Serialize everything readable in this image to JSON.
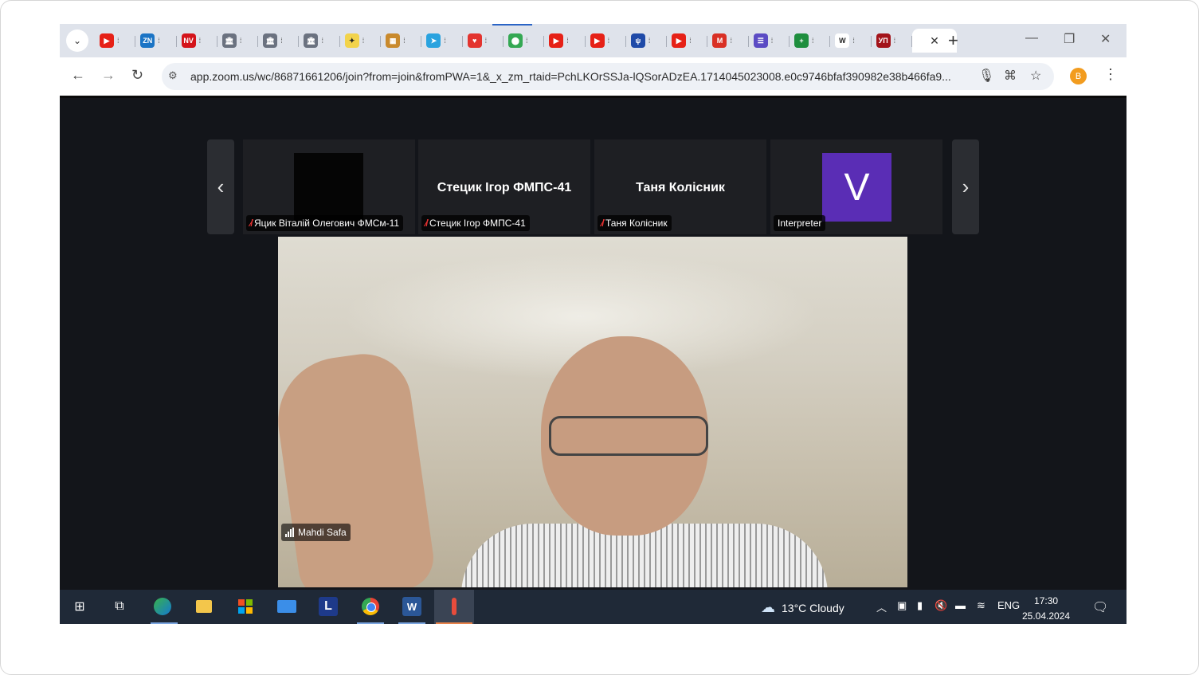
{
  "browser": {
    "tabs": [
      {
        "icon": "youtube-icon",
        "color": "#e62117",
        "glyph": "▶"
      },
      {
        "icon": "zn-icon",
        "color": "#1b74c5",
        "glyph": "ZN"
      },
      {
        "icon": "nv-icon",
        "color": "#d4141b",
        "glyph": "NV"
      },
      {
        "icon": "bank-icon",
        "color": "#6b7280",
        "glyph": "🏛"
      },
      {
        "icon": "bank-icon",
        "color": "#6b7280",
        "glyph": "🏛"
      },
      {
        "icon": "bank-icon",
        "color": "#6b7280",
        "glyph": "🏛"
      },
      {
        "icon": "star-icon",
        "color": "#f2d34b",
        "glyph": "✦"
      },
      {
        "icon": "basket-icon",
        "color": "#c98a2d",
        "glyph": "▦"
      },
      {
        "icon": "telegram-icon",
        "color": "#2aa3df",
        "glyph": "➤"
      },
      {
        "icon": "heart-icon",
        "color": "#e3342f",
        "glyph": "♥"
      },
      {
        "icon": "maps-icon",
        "color": "#34a853",
        "glyph": "⬤"
      },
      {
        "icon": "youtube-icon",
        "color": "#e62117",
        "glyph": "▶"
      },
      {
        "icon": "youtube-icon",
        "color": "#e62117",
        "glyph": "▶"
      },
      {
        "icon": "trident-icon",
        "color": "#1f4aa8",
        "glyph": "ψ"
      },
      {
        "icon": "youtube-icon",
        "color": "#e62117",
        "glyph": "▶"
      },
      {
        "icon": "gmail-icon",
        "color": "#d93025",
        "glyph": "M"
      },
      {
        "icon": "list-icon",
        "color": "#5b4bc4",
        "glyph": "☰"
      },
      {
        "icon": "sheets-plus-icon",
        "color": "#1e8e3e",
        "glyph": "+"
      },
      {
        "icon": "wikipedia-icon",
        "color": "#ffffff",
        "glyph": "W"
      },
      {
        "icon": "up-icon",
        "color": "#a3131a",
        "glyph": "УП"
      }
    ],
    "new_tab": "+",
    "url": "app.zoom.us/wc/86871661206/join?from=join&fromPWA=1&_x_zm_rtaid=PchLKOrSSJa-lQSorADzEA.1714045023008.e0c9746bfaf390982e38b466fa9...",
    "profile_initial": "B"
  },
  "zoom": {
    "participants": [
      {
        "label": "Яцик Віталій Олегович ФМСм-11",
        "muted": true,
        "view": "video-off"
      },
      {
        "label": "Стецик Ігор ФМПС-41",
        "display_name": "Стецик Ігор ФМПС-41",
        "muted": true
      },
      {
        "label": "Таня Колісник",
        "display_name": "Таня Колісник",
        "muted": true
      },
      {
        "label": "Interpreter",
        "avatar_letter": "V",
        "avatar_color": "#5a2db5",
        "muted": false
      }
    ],
    "speaker": {
      "name": "Mahdi Safa"
    }
  },
  "taskbar": {
    "weather": "13°C  Cloudy",
    "language": "ENG",
    "time": "17:30",
    "date": "25.04.2024",
    "l_app": "L",
    "word_app": "W"
  }
}
